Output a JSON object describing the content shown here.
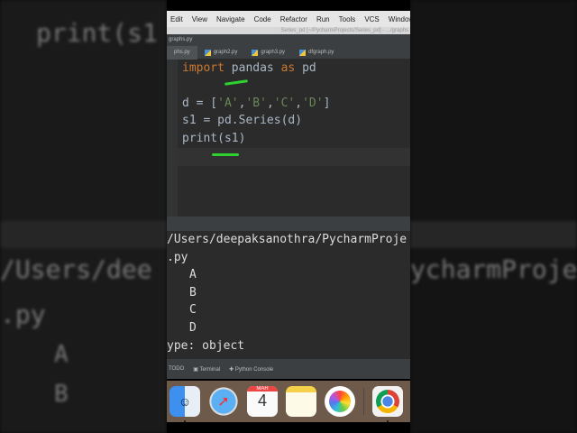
{
  "background": {
    "left_lines": [
      "print(s1",
      "/Users/dee",
      ".py",
      "A",
      "B"
    ],
    "right_lines": [
      "ycharmProje"
    ]
  },
  "menu": [
    "Edit",
    "View",
    "Navigate",
    "Code",
    "Refactor",
    "Run",
    "Tools",
    "VCS",
    "Window"
  ],
  "window_title": "Series_pd [~/PycharmProjects/Series_pd] - .../graphs",
  "breadcrumb": "graphs.py",
  "tabs": [
    "phs.py",
    "graph2.py",
    "graph3.py",
    "dfgraph.py"
  ],
  "code": {
    "l1_kw": "import",
    "l1_rest": " pandas ",
    "l1_as": "as",
    "l1_end": " pd",
    "l2_a": "d = [",
    "l2_s1": "'A'",
    "l2_s2": "'B'",
    "l2_s3": "'C'",
    "l2_s4": "'D'",
    "l2_end": "]",
    "l3": "s1 = pd.Series(d)",
    "l4": "print(s1)"
  },
  "output": {
    "path": "/Users/deepaksanothra/PycharmProje",
    "py": ".py",
    "rows": [
      "A",
      "B",
      "C",
      "D"
    ],
    "dtype": "ype: object"
  },
  "toolbar": {
    "todo": "TODO",
    "terminal": "Terminal",
    "console": "Python Console"
  },
  "dock": {
    "calendar_month": "MAR",
    "calendar_day": "4"
  }
}
